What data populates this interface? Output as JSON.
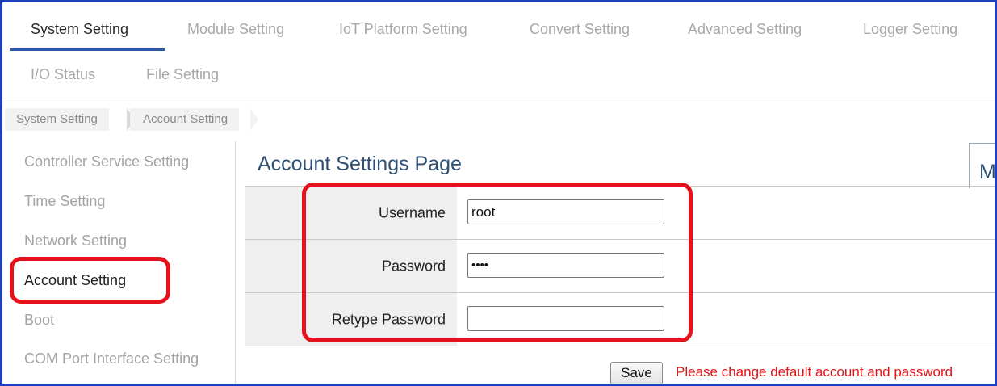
{
  "tabs": [
    {
      "label": "System Setting",
      "active": true
    },
    {
      "label": "Module Setting",
      "active": false
    },
    {
      "label": "IoT Platform Setting",
      "active": false
    },
    {
      "label": "Convert Setting",
      "active": false
    },
    {
      "label": "Advanced Setting",
      "active": false
    },
    {
      "label": "Logger Setting",
      "active": false
    },
    {
      "label": "I/O Status",
      "active": false
    },
    {
      "label": "File Setting",
      "active": false
    }
  ],
  "breadcrumb": [
    "System Setting",
    "Account Setting"
  ],
  "sidebar": {
    "items": [
      {
        "label": "Controller Service Setting",
        "active": false
      },
      {
        "label": "Time Setting",
        "active": false
      },
      {
        "label": "Network Setting",
        "active": false
      },
      {
        "label": "Account Setting",
        "active": true
      },
      {
        "label": "Boot",
        "active": false
      },
      {
        "label": "COM Port Interface Setting",
        "active": false
      }
    ]
  },
  "main": {
    "title": "Account Settings Page",
    "side_tab_label": "M",
    "form": {
      "username": {
        "label": "Username",
        "value": "root"
      },
      "password": {
        "label": "Password",
        "value": "••••"
      },
      "retype_password": {
        "label": "Retype Password",
        "value": ""
      }
    },
    "save_label": "Save",
    "warning": "Please change default account and password"
  },
  "colors": {
    "frame_border": "#1f3fbf",
    "highlight": "#e3121b",
    "title": "#2f4f73",
    "warning": "#e01818",
    "tab_underline": "#2b5aa8"
  }
}
